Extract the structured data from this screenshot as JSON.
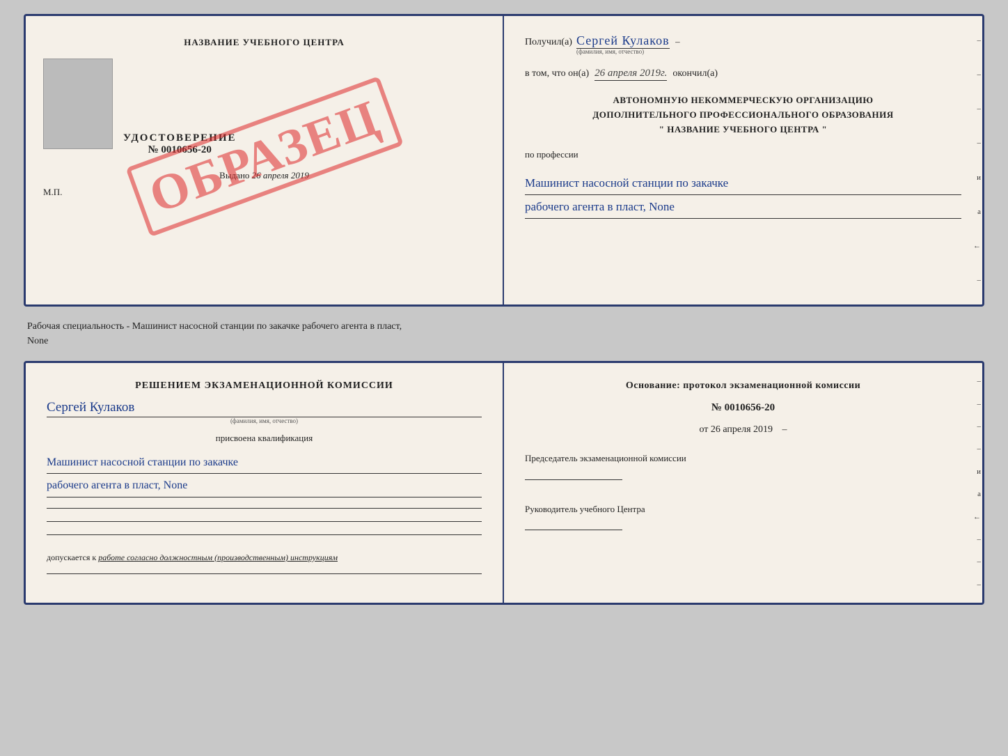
{
  "topCert": {
    "leftTitle": "НАЗВАНИЕ УЧЕБНОГО ЦЕНТРА",
    "stampText": "ОБРАЗЕЦ",
    "udostoverenie": "УДОСТОВЕРЕНИЕ",
    "number": "№ 0010656-20",
    "vydano": "Выдано",
    "vydanoDate": "26 апреля 2019",
    "mp": "М.П."
  },
  "topRight": {
    "poluchilLabel": "Получил(а)",
    "name": "Сергей Кулаков",
    "familiyaHint": "(фамилия, имя, отчество)",
    "vtomLabel": "в том, что он(а)",
    "date": "26 апреля 2019г.",
    "okonchilLabel": "окончил(а)",
    "avtTitle1": "АВТОНОМНУЮ НЕКОММЕРЧЕСКУЮ ОРГАНИЗАЦИЮ",
    "avtTitle2": "ДОПОЛНИТЕЛЬНОГО ПРОФЕССИОНАЛЬНОГО ОБРАЗОВАНИЯ",
    "avtName": "\" НАЗВАНИЕ УЧЕБНОГО ЦЕНТРА \"",
    "poProfessii": "по профессии",
    "profession1": "Машинист насосной станции по закачке",
    "profession2": "рабочего агента в пласт, None",
    "dashSymbols": [
      "–",
      "–",
      "–",
      "–",
      "и",
      "а",
      "←",
      "–"
    ]
  },
  "middleText": {
    "text": "Рабочая специальность - Машинист насосной станции по закачке рабочего агента в пласт,\nNone"
  },
  "bottomLeft": {
    "resheniemTitle": "Решением экзаменационной комиссии",
    "name": "Сергей Кулаков",
    "familiyaHint": "(фамилия, имя, отчество)",
    "prisvoenaText": "присвоена квалификация",
    "profession1": "Машинист насосной станции по закачке",
    "profession2": "рабочего агента в пласт, None",
    "dopuskaetsya": "допускается к",
    "dopuskaetsyaVal": "работе согласно должностным (производственным) инструкциям"
  },
  "bottomRight": {
    "osnovanie": "Основание: протокол экзаменационной комиссии",
    "number": "№ 0010656-20",
    "ot": "от",
    "date": "26 апреля 2019",
    "predsedatelLabel": "Председатель экзаменационной комиссии",
    "rukovoditelLabel": "Руководитель учебного Центра",
    "dashSymbols": [
      "–",
      "–",
      "–",
      "–",
      "и",
      "а",
      "←",
      "–",
      "–",
      "–"
    ]
  }
}
